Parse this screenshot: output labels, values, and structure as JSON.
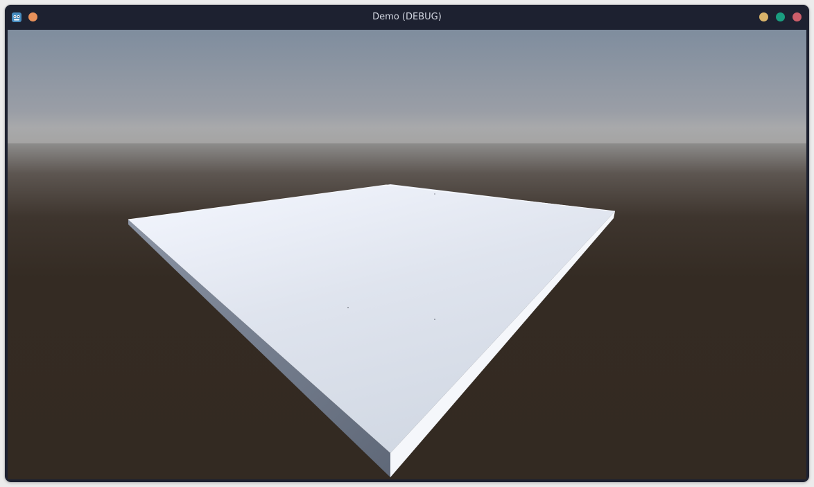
{
  "window": {
    "title": "Demo (DEBUG)",
    "app_icon": "godot-icon",
    "controls": [
      {
        "name": "menu-button",
        "color": "#e8915a"
      },
      {
        "name": "minimize-button",
        "color": "#d9b36a"
      },
      {
        "name": "maximize-button",
        "color": "#1a9e80"
      },
      {
        "name": "close-button",
        "color": "#cc5e6a"
      }
    ]
  },
  "scene": {
    "sky_top": "#7f8d9e",
    "sky_horizon": "#a6a7a9",
    "ground": "#332a22",
    "platform_top": "#dde2ec",
    "platform_left_side": "#6b7484",
    "platform_right_side": "#f4f6fa"
  }
}
